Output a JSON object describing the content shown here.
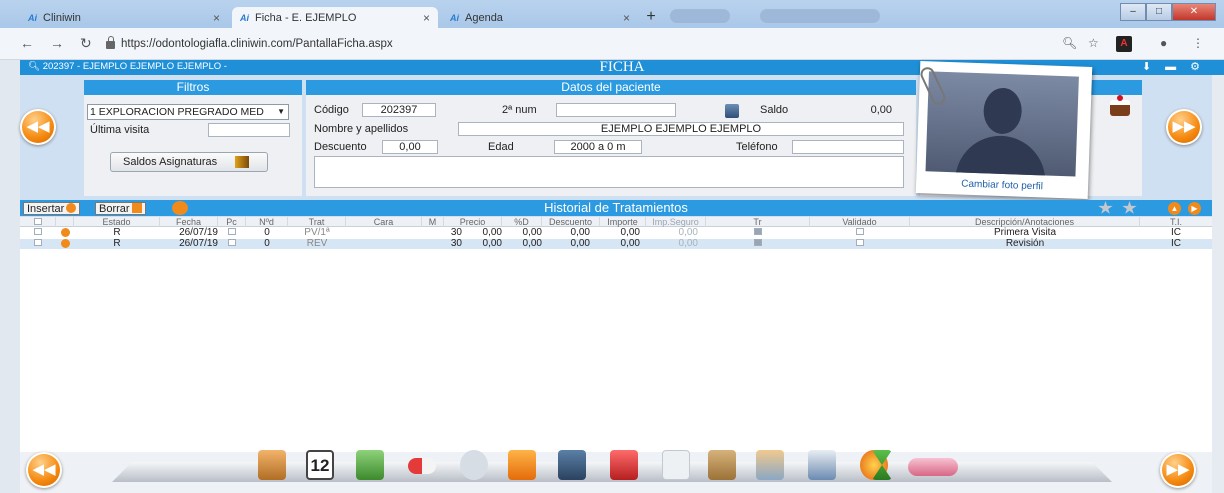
{
  "browser": {
    "tabs": [
      {
        "label": "Cliniwin",
        "favicon": "Ai",
        "active": false
      },
      {
        "label": "Ficha - E. EJEMPLO",
        "favicon": "Ai",
        "active": true
      },
      {
        "label": "Agenda",
        "favicon": "Ai",
        "active": false
      }
    ],
    "close_glyph": "×",
    "url": "https://odontologiafla.cliniwin.com/PantallaFicha.aspx"
  },
  "app": {
    "patient_header": "202397 - EJEMPLO EJEMPLO EJEMPLO -",
    "screen_title": "FICHA",
    "accent_color": "#2b9ae0",
    "orange_color": "#f08a1a"
  },
  "filtros": {
    "title": "Filtros",
    "selected": "1 EXPLORACION PREGRADO MED",
    "ultima_visita_label": "Última visita",
    "ultima_visita_value": "",
    "saldos_button": "Saldos Asignaturas"
  },
  "paciente": {
    "title": "Datos del paciente",
    "codigo_label": "Código",
    "codigo_value": "202397",
    "segundo_num_label": "2ª num",
    "segundo_num_value": "",
    "saldo_label": "Saldo",
    "saldo_value": "0,00",
    "nombre_label": "Nombre y apellidos",
    "nombre_value": "EJEMPLO EJEMPLO EJEMPLO",
    "descuento_label": "Descuento",
    "descuento_value": "0,00",
    "edad_label": "Edad",
    "edad_value": "2000 a 0 m",
    "telefono_label": "Teléfono",
    "telefono_value": "",
    "notes_value": ""
  },
  "photo": {
    "caption": "Cambiar foto perfil"
  },
  "historial": {
    "title": "Historial de Tratamientos",
    "insert_button": "Insertar",
    "delete_button": "Borrar",
    "columns": [
      "Estado",
      "Fecha",
      "Pc",
      "Nºd",
      "Trat",
      "Cara",
      "M",
      "Precio",
      "%D",
      "Descuento",
      "Importe",
      "Imp.Seguro",
      "Tr",
      "Validado",
      "Descripción/Anotaciones",
      "T.I."
    ],
    "rows": [
      {
        "estado": "R",
        "fecha": "26/07/19",
        "nd": "0",
        "trat": "PV/1ª",
        "cara": "",
        "m": "30",
        "precio": "0,00",
        "pd": "0,00",
        "descuento": "0,00",
        "importe": "0,00",
        "imp_seguro": "0,00",
        "tr": true,
        "validado": false,
        "descripcion": "Primera Visita",
        "ti": "IC"
      },
      {
        "estado": "R",
        "fecha": "26/07/19",
        "nd": "0",
        "trat": "REV",
        "cara": "",
        "m": "30",
        "precio": "0,00",
        "pd": "0,00",
        "descuento": "0,00",
        "importe": "0,00",
        "imp_seguro": "0,00",
        "tr": true,
        "validado": false,
        "descripcion": "Revisión",
        "ti": "IC"
      }
    ]
  },
  "dock": {
    "calendar_day": "12"
  }
}
